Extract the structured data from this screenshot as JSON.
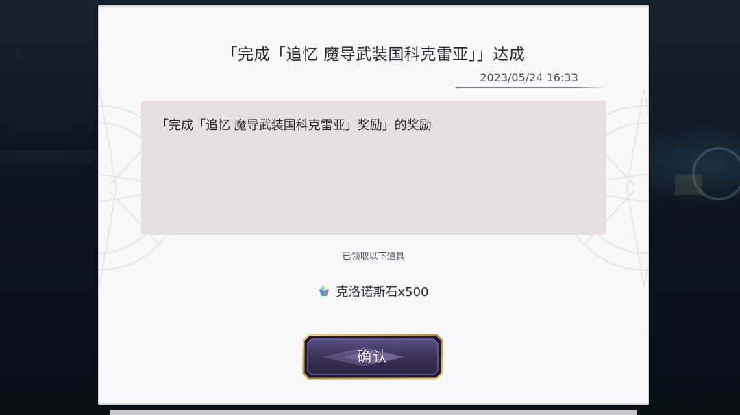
{
  "dialog": {
    "title": "「完成「追忆 魔导武装国科克雷亚」」达成",
    "timestamp": "2023/05/24 16:33",
    "message": "「完成「追忆 魔导武装国科克雷亚」奖励」的奖励",
    "received_label": "已领取以下道具",
    "reward": {
      "icon": "chronos-stone-icon",
      "text": "克洛诺斯石x500"
    },
    "confirm_label": "确认"
  },
  "colors": {
    "panel": "#f8f7f9",
    "message_box": "#e9dfe3",
    "button_fill": "#3b3158",
    "button_border": "#c9a85a"
  }
}
